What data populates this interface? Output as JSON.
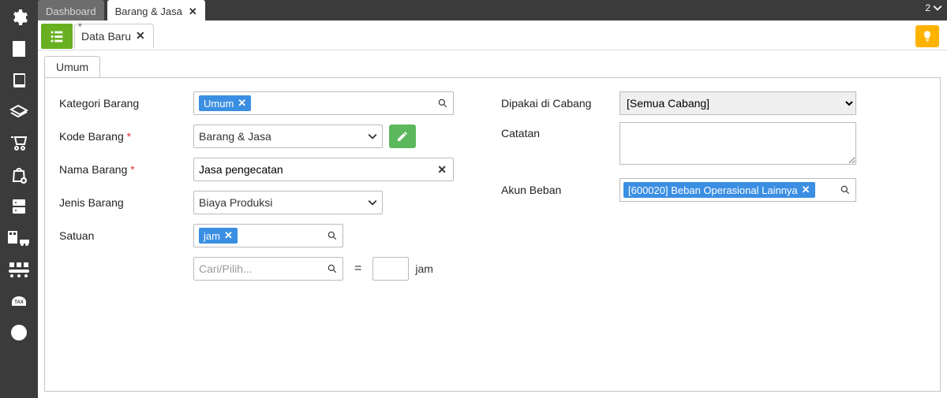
{
  "topTabs": {
    "inactive": "Dashboard",
    "active": "Barang & Jasa"
  },
  "badgeCount": "2",
  "docTab": {
    "dirtyMark": "*",
    "title": "Data Baru"
  },
  "sectionTab": "Umum",
  "form": {
    "kategori": {
      "label": "Kategori Barang",
      "chip": "Umum"
    },
    "kode": {
      "label": "Kode Barang",
      "value": "Barang & Jasa"
    },
    "nama": {
      "label": "Nama Barang",
      "value": "Jasa pengecatan"
    },
    "jenis": {
      "label": "Jenis Barang",
      "value": "Biaya Produksi"
    },
    "satuan": {
      "label": "Satuan",
      "chip": "jam",
      "searchPlaceholder": "Cari/Pilih...",
      "eq": "=",
      "unit": "jam"
    },
    "cabang": {
      "label": "Dipakai di Cabang",
      "value": "[Semua Cabang]"
    },
    "catatan": {
      "label": "Catatan",
      "value": ""
    },
    "akun": {
      "label": "Akun Beban",
      "chip": "[600020] Beban Operasional Lainnya"
    }
  }
}
